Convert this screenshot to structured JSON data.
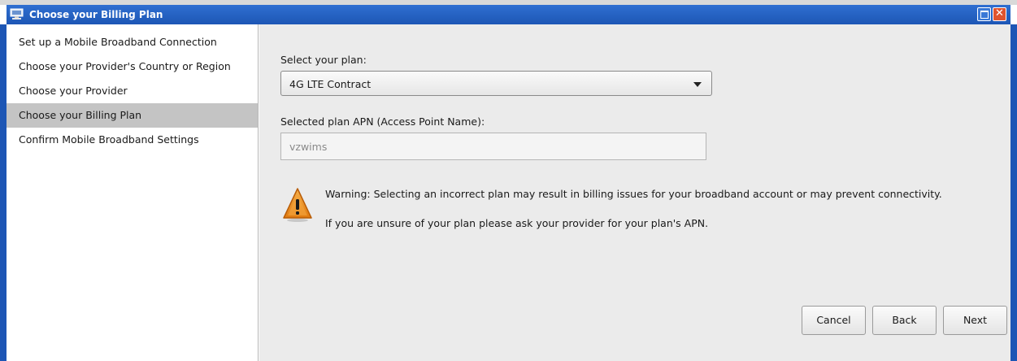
{
  "window": {
    "title": "Choose your Billing Plan",
    "close_glyph": "✕",
    "icons": {
      "app": "network-computer-icon",
      "maximize": "maximize-icon",
      "close": "close-icon"
    },
    "colors": {
      "titlebar": "#1d56b5",
      "close": "#e0542f"
    }
  },
  "sidebar": {
    "items": [
      {
        "label": "Set up a Mobile Broadband Connection"
      },
      {
        "label": "Choose your Provider's Country or Region"
      },
      {
        "label": "Choose your Provider"
      },
      {
        "label": "Choose your Billing Plan",
        "active": true
      },
      {
        "label": "Confirm Mobile Broadband Settings"
      }
    ]
  },
  "form": {
    "plan_label": "Select your plan:",
    "plan_value": "4G LTE Contract",
    "apn_label": "Selected plan APN (Access Point Name):",
    "apn_value": "vzwims"
  },
  "warning": {
    "icon": "warning-icon",
    "line1": "Warning: Selecting an incorrect plan may result in billing issues for your broadband account or may prevent connectivity.",
    "line2": "If you are unsure of your plan please ask your provider for your plan's APN."
  },
  "buttons": {
    "cancel": "Cancel",
    "back": "Back",
    "next": "Next"
  }
}
